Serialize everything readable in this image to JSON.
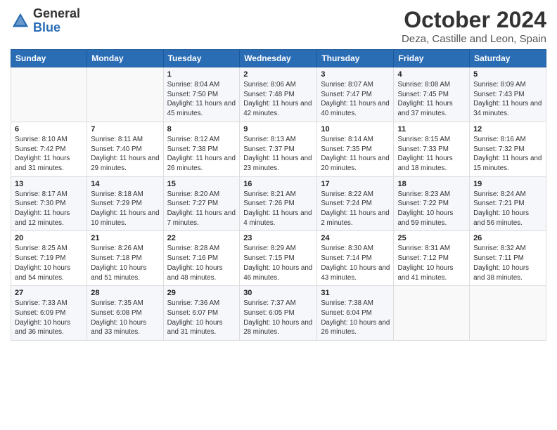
{
  "header": {
    "logo": {
      "general": "General",
      "blue": "Blue"
    },
    "month_title": "October 2024",
    "location": "Deza, Castille and Leon, Spain"
  },
  "days_of_week": [
    "Sunday",
    "Monday",
    "Tuesday",
    "Wednesday",
    "Thursday",
    "Friday",
    "Saturday"
  ],
  "weeks": [
    [
      {
        "day": "",
        "info": ""
      },
      {
        "day": "",
        "info": ""
      },
      {
        "day": "1",
        "sunrise": "Sunrise: 8:04 AM",
        "sunset": "Sunset: 7:50 PM",
        "daylight": "Daylight: 11 hours and 45 minutes."
      },
      {
        "day": "2",
        "sunrise": "Sunrise: 8:06 AM",
        "sunset": "Sunset: 7:48 PM",
        "daylight": "Daylight: 11 hours and 42 minutes."
      },
      {
        "day": "3",
        "sunrise": "Sunrise: 8:07 AM",
        "sunset": "Sunset: 7:47 PM",
        "daylight": "Daylight: 11 hours and 40 minutes."
      },
      {
        "day": "4",
        "sunrise": "Sunrise: 8:08 AM",
        "sunset": "Sunset: 7:45 PM",
        "daylight": "Daylight: 11 hours and 37 minutes."
      },
      {
        "day": "5",
        "sunrise": "Sunrise: 8:09 AM",
        "sunset": "Sunset: 7:43 PM",
        "daylight": "Daylight: 11 hours and 34 minutes."
      }
    ],
    [
      {
        "day": "6",
        "sunrise": "Sunrise: 8:10 AM",
        "sunset": "Sunset: 7:42 PM",
        "daylight": "Daylight: 11 hours and 31 minutes."
      },
      {
        "day": "7",
        "sunrise": "Sunrise: 8:11 AM",
        "sunset": "Sunset: 7:40 PM",
        "daylight": "Daylight: 11 hours and 29 minutes."
      },
      {
        "day": "8",
        "sunrise": "Sunrise: 8:12 AM",
        "sunset": "Sunset: 7:38 PM",
        "daylight": "Daylight: 11 hours and 26 minutes."
      },
      {
        "day": "9",
        "sunrise": "Sunrise: 8:13 AM",
        "sunset": "Sunset: 7:37 PM",
        "daylight": "Daylight: 11 hours and 23 minutes."
      },
      {
        "day": "10",
        "sunrise": "Sunrise: 8:14 AM",
        "sunset": "Sunset: 7:35 PM",
        "daylight": "Daylight: 11 hours and 20 minutes."
      },
      {
        "day": "11",
        "sunrise": "Sunrise: 8:15 AM",
        "sunset": "Sunset: 7:33 PM",
        "daylight": "Daylight: 11 hours and 18 minutes."
      },
      {
        "day": "12",
        "sunrise": "Sunrise: 8:16 AM",
        "sunset": "Sunset: 7:32 PM",
        "daylight": "Daylight: 11 hours and 15 minutes."
      }
    ],
    [
      {
        "day": "13",
        "sunrise": "Sunrise: 8:17 AM",
        "sunset": "Sunset: 7:30 PM",
        "daylight": "Daylight: 11 hours and 12 minutes."
      },
      {
        "day": "14",
        "sunrise": "Sunrise: 8:18 AM",
        "sunset": "Sunset: 7:29 PM",
        "daylight": "Daylight: 11 hours and 10 minutes."
      },
      {
        "day": "15",
        "sunrise": "Sunrise: 8:20 AM",
        "sunset": "Sunset: 7:27 PM",
        "daylight": "Daylight: 11 hours and 7 minutes."
      },
      {
        "day": "16",
        "sunrise": "Sunrise: 8:21 AM",
        "sunset": "Sunset: 7:26 PM",
        "daylight": "Daylight: 11 hours and 4 minutes."
      },
      {
        "day": "17",
        "sunrise": "Sunrise: 8:22 AM",
        "sunset": "Sunset: 7:24 PM",
        "daylight": "Daylight: 11 hours and 2 minutes."
      },
      {
        "day": "18",
        "sunrise": "Sunrise: 8:23 AM",
        "sunset": "Sunset: 7:22 PM",
        "daylight": "Daylight: 10 hours and 59 minutes."
      },
      {
        "day": "19",
        "sunrise": "Sunrise: 8:24 AM",
        "sunset": "Sunset: 7:21 PM",
        "daylight": "Daylight: 10 hours and 56 minutes."
      }
    ],
    [
      {
        "day": "20",
        "sunrise": "Sunrise: 8:25 AM",
        "sunset": "Sunset: 7:19 PM",
        "daylight": "Daylight: 10 hours and 54 minutes."
      },
      {
        "day": "21",
        "sunrise": "Sunrise: 8:26 AM",
        "sunset": "Sunset: 7:18 PM",
        "daylight": "Daylight: 10 hours and 51 minutes."
      },
      {
        "day": "22",
        "sunrise": "Sunrise: 8:28 AM",
        "sunset": "Sunset: 7:16 PM",
        "daylight": "Daylight: 10 hours and 48 minutes."
      },
      {
        "day": "23",
        "sunrise": "Sunrise: 8:29 AM",
        "sunset": "Sunset: 7:15 PM",
        "daylight": "Daylight: 10 hours and 46 minutes."
      },
      {
        "day": "24",
        "sunrise": "Sunrise: 8:30 AM",
        "sunset": "Sunset: 7:14 PM",
        "daylight": "Daylight: 10 hours and 43 minutes."
      },
      {
        "day": "25",
        "sunrise": "Sunrise: 8:31 AM",
        "sunset": "Sunset: 7:12 PM",
        "daylight": "Daylight: 10 hours and 41 minutes."
      },
      {
        "day": "26",
        "sunrise": "Sunrise: 8:32 AM",
        "sunset": "Sunset: 7:11 PM",
        "daylight": "Daylight: 10 hours and 38 minutes."
      }
    ],
    [
      {
        "day": "27",
        "sunrise": "Sunrise: 7:33 AM",
        "sunset": "Sunset: 6:09 PM",
        "daylight": "Daylight: 10 hours and 36 minutes."
      },
      {
        "day": "28",
        "sunrise": "Sunrise: 7:35 AM",
        "sunset": "Sunset: 6:08 PM",
        "daylight": "Daylight: 10 hours and 33 minutes."
      },
      {
        "day": "29",
        "sunrise": "Sunrise: 7:36 AM",
        "sunset": "Sunset: 6:07 PM",
        "daylight": "Daylight: 10 hours and 31 minutes."
      },
      {
        "day": "30",
        "sunrise": "Sunrise: 7:37 AM",
        "sunset": "Sunset: 6:05 PM",
        "daylight": "Daylight: 10 hours and 28 minutes."
      },
      {
        "day": "31",
        "sunrise": "Sunrise: 7:38 AM",
        "sunset": "Sunset: 6:04 PM",
        "daylight": "Daylight: 10 hours and 26 minutes."
      },
      {
        "day": "",
        "info": ""
      },
      {
        "day": "",
        "info": ""
      }
    ]
  ]
}
